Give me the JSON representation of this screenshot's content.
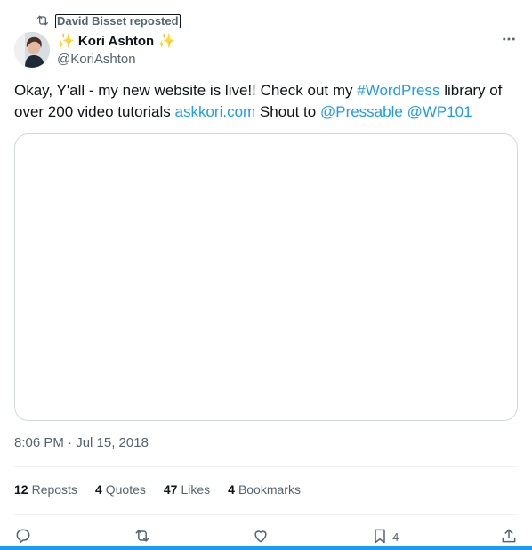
{
  "repost": {
    "label": "David Bisset reposted"
  },
  "author": {
    "name": "Kori Ashton",
    "emoji_left": "✨",
    "emoji_right": "✨",
    "handle": "@KoriAshton"
  },
  "tweet": {
    "text_1": "Okay, Y'all - my new website is live!!  Check out my ",
    "hashtag": "#WordPress",
    "text_2": " library of over 200 video tutorials ",
    "link": "askkori.com",
    "text_3": "  Shout to ",
    "mention_1": "@Pressable",
    "text_4": " ",
    "mention_2": "@WP101"
  },
  "timestamp": "8:06 PM · Jul 15, 2018",
  "stats": {
    "reposts_count": "12",
    "reposts_label": "Reposts",
    "quotes_count": "4",
    "quotes_label": "Quotes",
    "likes_count": "47",
    "likes_label": "Likes",
    "bookmarks_count": "4",
    "bookmarks_label": "Bookmarks"
  },
  "actions": {
    "bookmark_count": "4"
  },
  "icons": [
    "repost-icon",
    "more-icon",
    "reply-icon",
    "retweet-icon",
    "like-icon",
    "bookmark-icon",
    "share-icon"
  ],
  "colors": {
    "accent": "#1d9bf0",
    "muted": "#536471",
    "text": "#0f1419",
    "border": "#cfd9de"
  }
}
